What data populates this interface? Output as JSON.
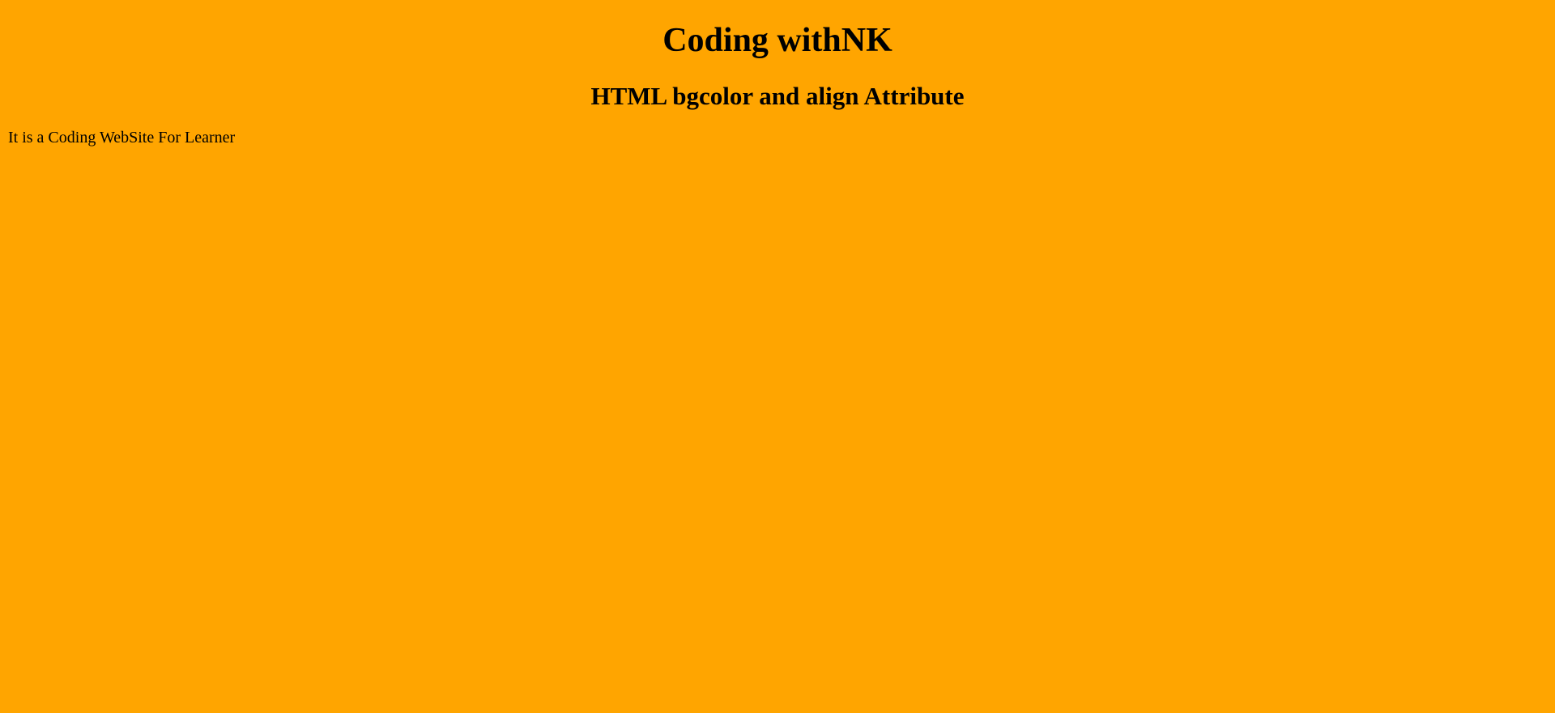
{
  "page": {
    "background_color": "#FFA500",
    "text_color": "#000000"
  },
  "content": {
    "heading": "Coding withNK",
    "subheading": "HTML bgcolor and align Attribute",
    "paragraph": "It is a Coding WebSite For Learner"
  }
}
